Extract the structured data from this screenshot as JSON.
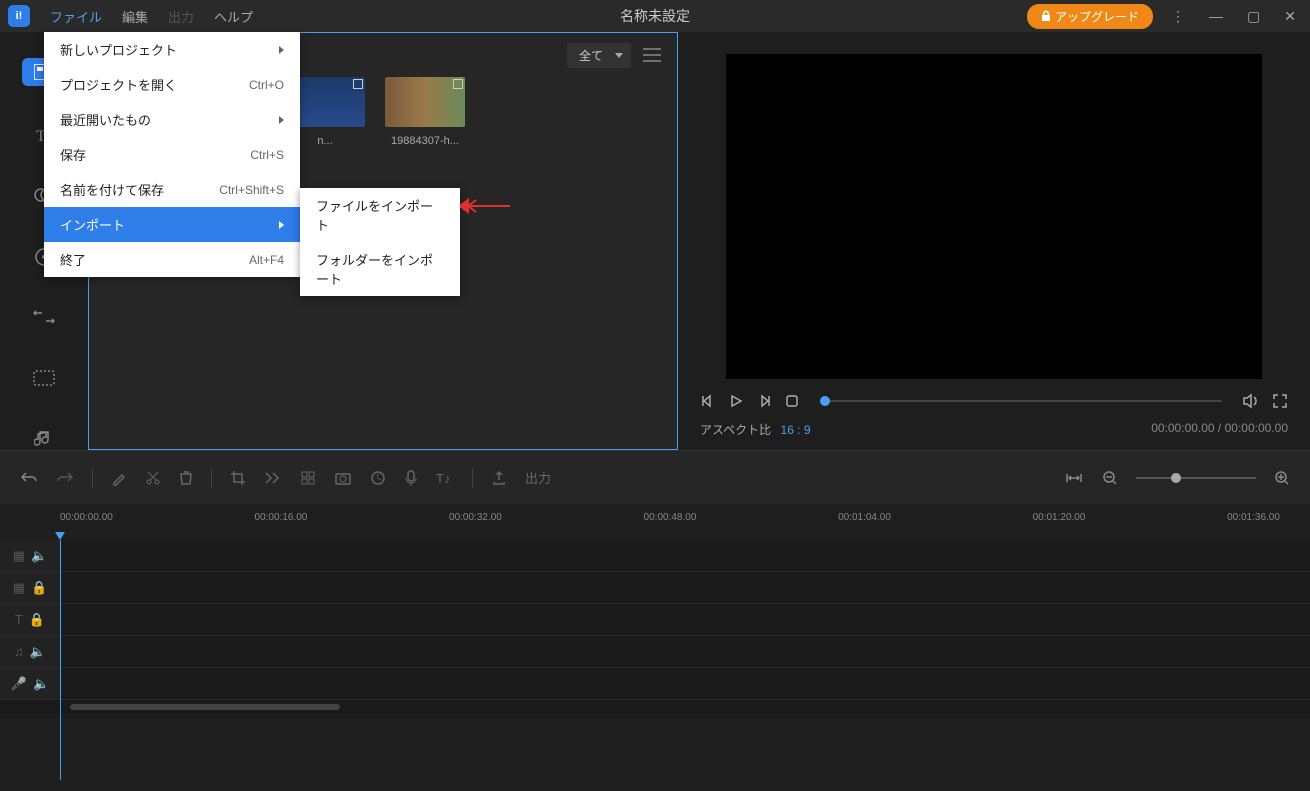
{
  "titlebar": {
    "title": "名称未設定",
    "upgrade": "アップグレード"
  },
  "menu": {
    "file": "ファイル",
    "edit": "編集",
    "output": "出力",
    "help": "ヘルプ"
  },
  "file_menu": {
    "new_project": "新しいプロジェクト",
    "open_project": "プロジェクトを開く",
    "open_project_sc": "Ctrl+O",
    "recent": "最近開いたもの",
    "save": "保存",
    "save_sc": "Ctrl+S",
    "save_as": "名前を付けて保存",
    "save_as_sc": "Ctrl+Shift+S",
    "import": "インポート",
    "exit": "終了",
    "exit_sc": "Alt+F4"
  },
  "import_submenu": {
    "import_file": "ファイルをインポート",
    "import_folder": "フォルダーをインポート"
  },
  "media": {
    "filter": "全て",
    "item1": "n...",
    "item2": "19884307-h..."
  },
  "preview": {
    "aspect_label": "アスペクト比",
    "aspect_value": "16 : 9",
    "time": "00:00:00.00 / 00:00:00.00"
  },
  "timeline": {
    "export": "出力",
    "ticks": [
      "00:00:00.00",
      "00:00:16.00",
      "00:00:32.00",
      "00:00:48.00",
      "00:01:04.00",
      "00:01:20.00",
      "00:01:36.00"
    ]
  }
}
